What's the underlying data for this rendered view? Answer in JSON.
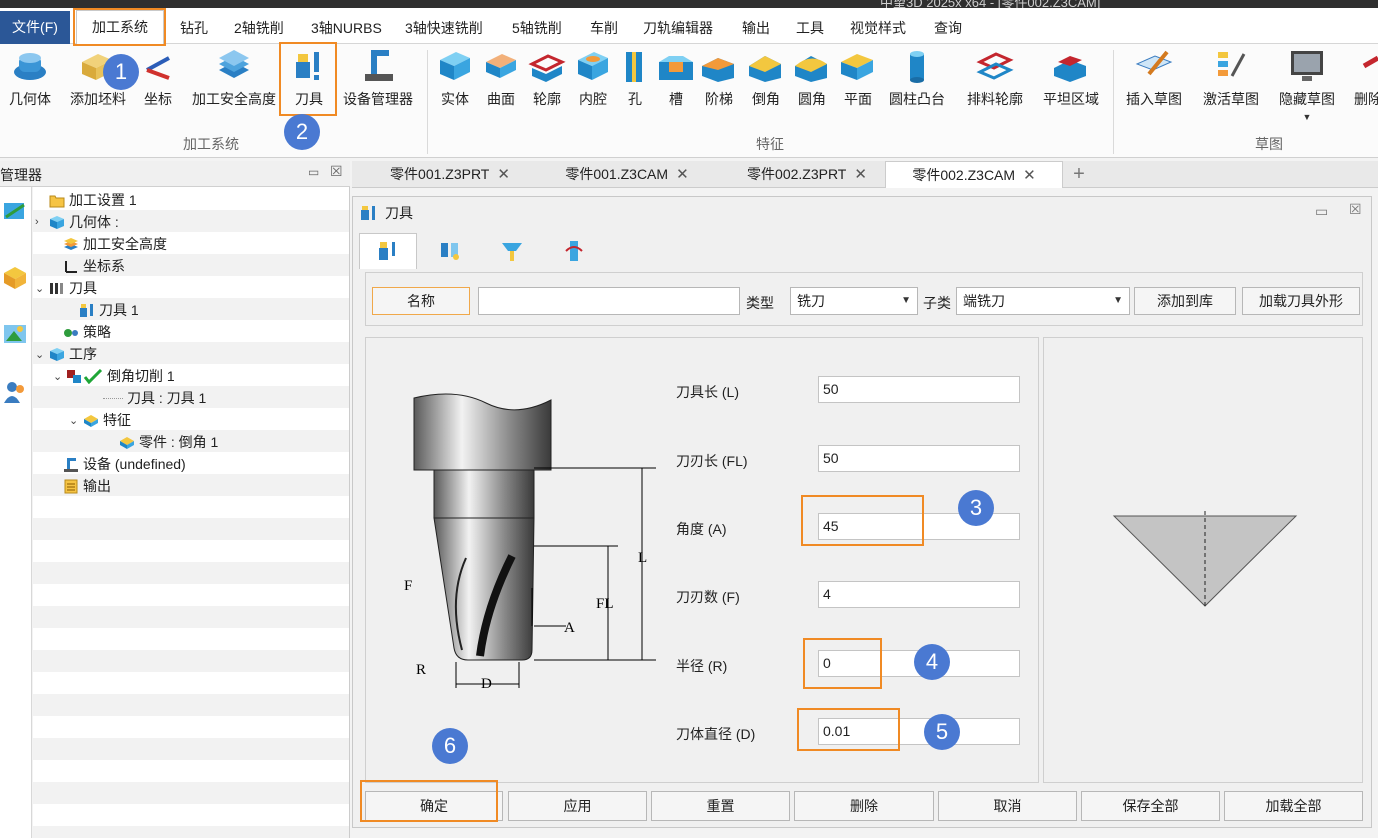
{
  "window": {
    "title_partial": "中望3D 2025x x64 - [零件002.Z3CAM]"
  },
  "menubar": {
    "file": "文件(F)",
    "items": [
      "加工系统",
      "钻孔",
      "2轴铣削",
      "3轴NURBS",
      "3轴快速铣削",
      "5轴铣削",
      "车削",
      "刀轨编辑器",
      "输出",
      "工具",
      "视觉样式",
      "查询"
    ]
  },
  "ribbon": {
    "group_machining": {
      "label": "加工系统",
      "buttons": [
        "几何体",
        "添加坯料",
        "坐标",
        "加工安全高度",
        "刀具",
        "设备管理器"
      ]
    },
    "group_feature": {
      "label": "特征",
      "buttons": [
        "实体",
        "曲面",
        "轮廓",
        "内腔",
        "孔",
        "槽",
        "阶梯",
        "倒角",
        "圆角",
        "平面",
        "圆柱凸台",
        "排料轮廓",
        "平坦区域"
      ]
    },
    "group_sketch": {
      "label": "草图",
      "buttons": [
        "插入草图",
        "激活草图",
        "隐藏草图",
        "删除"
      ]
    }
  },
  "manager": {
    "title": "管理器",
    "tree": [
      {
        "label": "加工设置 1"
      },
      {
        "label": "几何体 :"
      },
      {
        "label": "加工安全高度"
      },
      {
        "label": "坐标系"
      },
      {
        "label": "刀具"
      },
      {
        "label": "刀具 1"
      },
      {
        "label": "策略"
      },
      {
        "label": "工序"
      },
      {
        "label": "倒角切削 1"
      },
      {
        "label": "刀具 : 刀具 1"
      },
      {
        "label": "特征"
      },
      {
        "label": "零件 : 倒角 1"
      },
      {
        "label": "设备 (undefined)"
      },
      {
        "label": "输出"
      }
    ]
  },
  "doc_tabs": [
    "零件001.Z3PRT",
    "零件001.Z3CAM",
    "零件002.Z3PRT",
    "零件002.Z3CAM"
  ],
  "dialog": {
    "title": "刀具",
    "name_label": "名称",
    "name_value": "",
    "type_label": "类型",
    "type_value": "铣刀",
    "subtype_label": "子类",
    "subtype_value": "端铣刀",
    "add_to_lib": "添加到库",
    "load_shape": "加载刀具外形",
    "params": [
      {
        "label": "刀具长 (L)",
        "value": "50"
      },
      {
        "label": "刀刃长 (FL)",
        "value": "50"
      },
      {
        "label": "角度 (A)",
        "value": "45"
      },
      {
        "label": "刀刃数 (F)",
        "value": "4"
      },
      {
        "label": "半径 (R)",
        "value": "0"
      },
      {
        "label": "刀体直径 (D)",
        "value": "0.01"
      }
    ],
    "diagram_labels": {
      "F": "F",
      "L": "L",
      "FL": "FL",
      "A": "A",
      "R": "R",
      "D": "D"
    },
    "buttons": [
      "确定",
      "应用",
      "重置",
      "删除",
      "取消",
      "保存全部",
      "加载全部"
    ]
  },
  "annotations": {
    "badges": [
      "1",
      "2",
      "3",
      "4",
      "5",
      "6"
    ],
    "color": "#f08a24",
    "badge_color": "#4a79d2"
  }
}
